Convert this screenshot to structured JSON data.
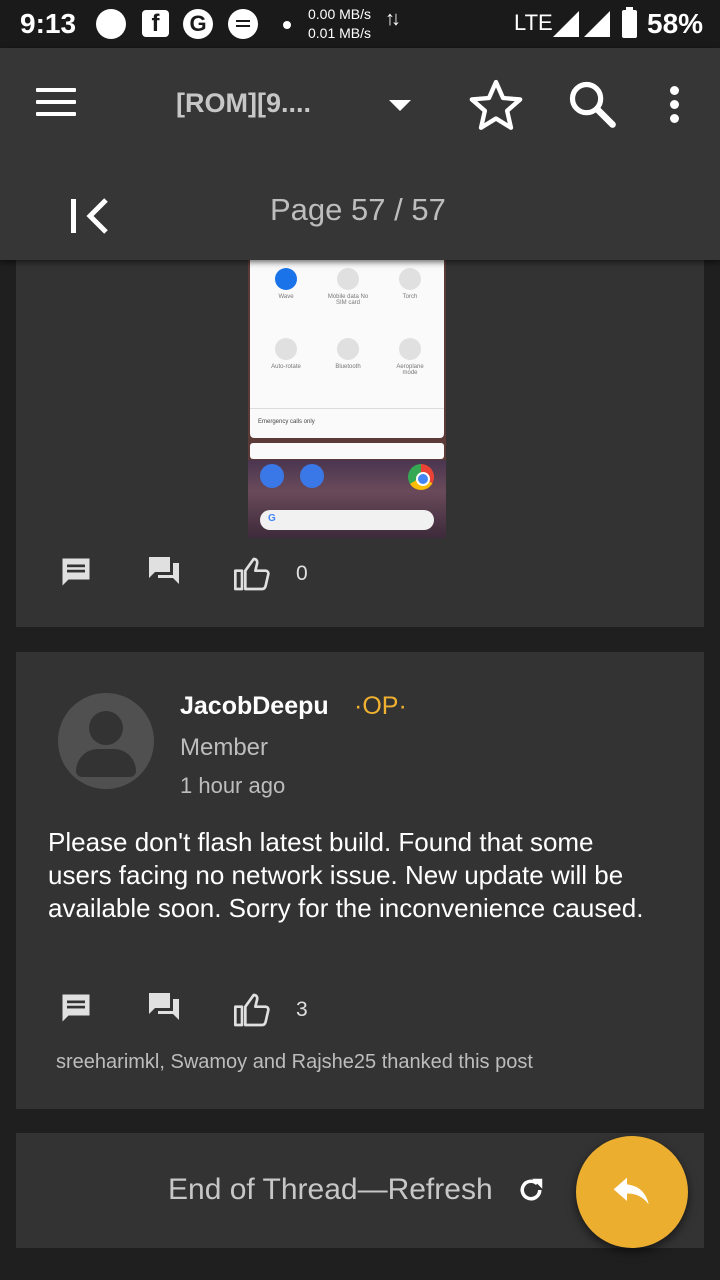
{
  "status_bar": {
    "time": "9:13",
    "fb_glyph": "f",
    "g_glyph": "G",
    "upload_speed": "0.00 MB/s",
    "download_speed": "0.01 MB/s",
    "network_type": "LTE",
    "battery": "58%"
  },
  "toolbar": {
    "title": "[ROM][9....",
    "page_label": "Page 57 / 57",
    "icons": [
      "menu-icon",
      "chevron-down-icon",
      "star-icon",
      "search-icon",
      "more-vert-icon",
      "first-page-icon"
    ]
  },
  "post1": {
    "screenshot": {
      "tiles": [
        "Wave",
        "Mobile data\nNo SIM card",
        "Torch",
        "Auto-rotate",
        "Bluetooth",
        "Aeroplane mode"
      ],
      "bar_text": "Emergency calls only",
      "search_glyph": "G"
    },
    "like_count": "0"
  },
  "post2": {
    "author": "JacobDeepu",
    "op_badge": "·OP·",
    "role": "Member",
    "time_ago": "1 hour ago",
    "body": "Please don't flash latest build. Found that some users facing no network issue. New update will be available soon. Sorry for the inconvenience caused.",
    "like_count": "3",
    "thanks_text": "sreeharimkl, Swamoy and Rajshe25 thanked this post"
  },
  "footer": {
    "end_label": "End of Thread—Refresh"
  },
  "colors": {
    "toolbar_bg": "#363636",
    "card_bg": "#333333",
    "accent_op": "#f0b030",
    "fab": "#ecae2f"
  }
}
